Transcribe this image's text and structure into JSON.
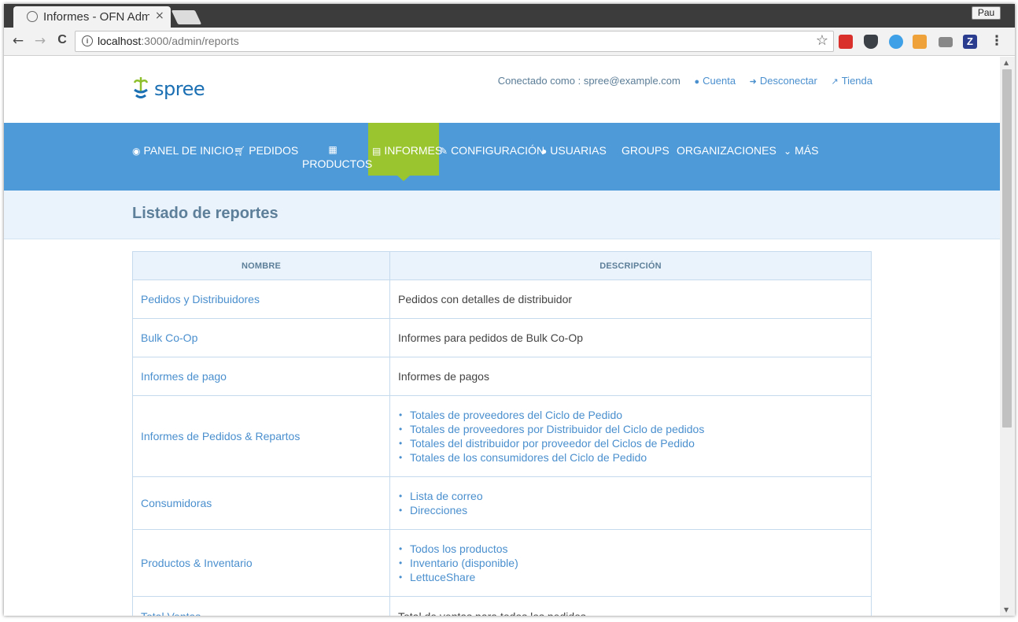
{
  "browser": {
    "tab_title": "Informes - OFN Adm",
    "tab_close": "×",
    "profile": "Pau",
    "url_host": "localhost",
    "url_rest": ":3000/admin/reports",
    "info_icon_glyph": "i",
    "back": "←",
    "forward": "→",
    "reload": "C",
    "star": "☆",
    "menu": "⋮"
  },
  "header": {
    "logo_text": "spree",
    "logged_in_as": "Conectado como : spree@example.com",
    "account": "Cuenta",
    "logout": "Desconectar",
    "store": "Tienda"
  },
  "nav": {
    "dashboard": "PANEL DE INICIO",
    "orders": "PEDIDOS",
    "products": "PRODUCTOS",
    "reports": "INFORMES",
    "configuration": "CONFIGURACIÓN",
    "users": "USUARIAS",
    "groups": "GROUPS",
    "organizations": "ORGANIZACIONES",
    "more": "MÁS"
  },
  "page": {
    "title": "Listado de reportes"
  },
  "table": {
    "col_name": "NOMBRE",
    "col_description": "DESCRIPCIÓN",
    "rows": [
      {
        "name": "Pedidos y Distribuidores",
        "description": "Pedidos con detalles de distribuidor"
      },
      {
        "name": "Bulk Co-Op",
        "description": "Informes para pedidos de Bulk Co-Op"
      },
      {
        "name": "Informes de pago",
        "description": "Informes de pagos"
      },
      {
        "name": "Informes de Pedidos & Repartos",
        "links": [
          "Totales de proveedores del Ciclo de Pedido",
          "Totales de proveedores por Distribuidor del Ciclo de pedidos",
          "Totales del distribuidor por proveedor del Ciclos de Pedido",
          "Totales de los consumidores del Ciclo de Pedido"
        ]
      },
      {
        "name": "Consumidoras",
        "links": [
          "Lista de correo",
          "Direcciones"
        ]
      },
      {
        "name": "Productos & Inventario",
        "links": [
          "Todos los productos",
          "Inventario (disponible)",
          "LettuceShare"
        ]
      },
      {
        "name": "Total Ventas",
        "description": "Total de ventas para todos los pedidos"
      }
    ]
  },
  "colors": {
    "nav_bg": "#4e9ad8",
    "nav_active": "#9ac52f",
    "link": "#4a8fce",
    "heading": "#5d7f99"
  }
}
